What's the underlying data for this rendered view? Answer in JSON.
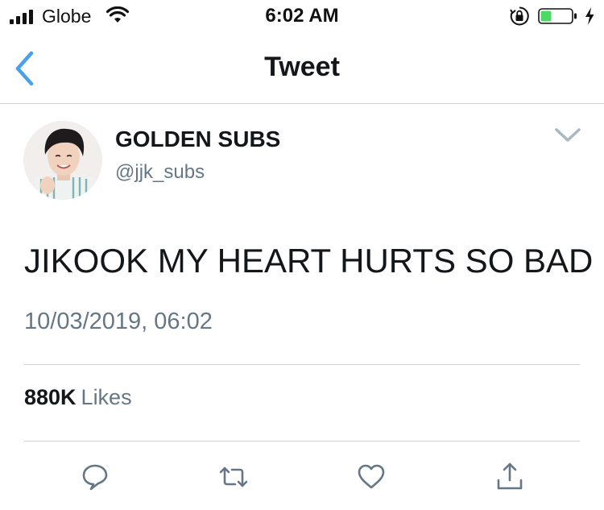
{
  "status_bar": {
    "carrier": "Globe",
    "time": "6:02 AM",
    "icons": [
      "signal-icon",
      "wifi-icon",
      "orientation-lock-icon",
      "battery-icon",
      "charging-bolt-icon"
    ],
    "battery_color": "#4cd964"
  },
  "nav": {
    "title": "Tweet",
    "back_icon": "chevron-left-icon",
    "accent_color": "#4aa1eb"
  },
  "tweet": {
    "display_name": "GOLDEN SUBS",
    "handle": "@jjk_subs",
    "text": "JIKOOK MY HEART HURTS SO BAD",
    "timestamp": "10/03/2019, 06:02",
    "likes_count": "880K",
    "likes_label": "Likes",
    "menu_icon": "chevron-down-icon"
  },
  "actions": [
    {
      "name": "reply",
      "icon": "reply-icon"
    },
    {
      "name": "retweet",
      "icon": "retweet-icon"
    },
    {
      "name": "like",
      "icon": "heart-icon"
    },
    {
      "name": "share",
      "icon": "share-icon"
    }
  ],
  "colors": {
    "text_primary": "#14171a",
    "text_secondary": "#657786",
    "divider": "#cfd3d6"
  }
}
